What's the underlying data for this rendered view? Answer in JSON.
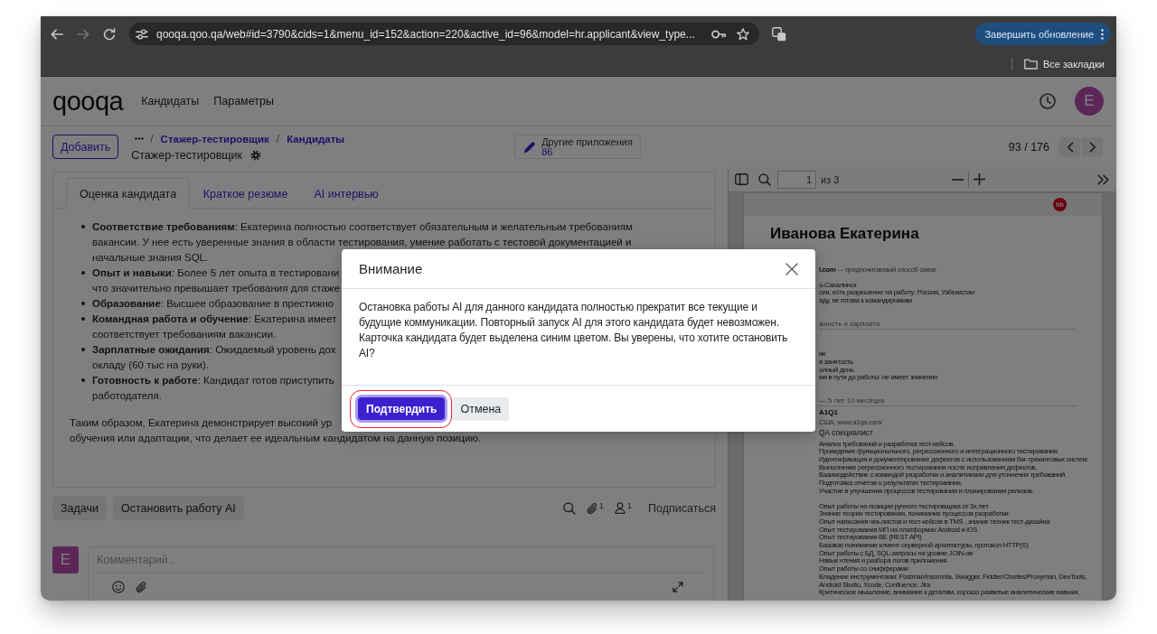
{
  "browser": {
    "nav": [
      {
        "kind": "back",
        "disabled": false
      },
      {
        "kind": "forward",
        "disabled": true
      },
      {
        "kind": "reload",
        "disabled": false
      }
    ],
    "url": "qooqa.qoo.qa/web#id=3790&cids=1&menu_id=152&action=220&active_id=96&model=hr.applicant&view_type...",
    "update_button": "Завершить обновление",
    "bookmarks_folder": "Все закладки"
  },
  "app_header": {
    "logo": "qooqa",
    "menu": [
      "Кандидаты",
      "Параметры"
    ],
    "avatar": "E"
  },
  "control_panel": {
    "new_button": "Добавить",
    "breadcrumbs": [
      {
        "separator": "/",
        "label": "Стажер-тестировщик"
      },
      {
        "separator": "/",
        "label": "Кандидаты"
      }
    ],
    "record_title": "Стажер-тестировщик",
    "smart_button": {
      "label": "Другие приложения",
      "count": "86"
    },
    "pager": "93 / 176"
  },
  "notebook": {
    "tabs": [
      {
        "label": "Оценка кандидата",
        "selected": true
      },
      {
        "label": "Краткое резюме",
        "selected": false
      },
      {
        "label": "AI интервью",
        "selected": false
      }
    ],
    "items": [
      {
        "lines": [
          "**Соответствие требованиям**: Екатерина полностью соответствует обязательным и желательным требованиям",
          "вакансии. У нее есть уверенные знания в области тестирования, умение работать с тестовой документацией и",
          "начальные знания SQL."
        ]
      },
      {
        "lines": [
          "**Опыт и навыки**: Более 5 лет опыта в тестировани",
          "что значительно превышает требования для стаже"
        ]
      },
      {
        "lines": [
          "**Образование**: Высшее образование в престижно"
        ]
      },
      {
        "lines": [
          "**Командная работа и обучение**: Екатерина имеет",
          "соответствует требованиям вакансии."
        ]
      },
      {
        "lines": [
          "**Зарплатные ожидания**: Ожидаемый уровень дох",
          "окладу (60 тыс на руки)."
        ]
      },
      {
        "lines": [
          "**Готовность к работе**: Кандидат готов приступить",
          "работодателя."
        ]
      }
    ],
    "summary": [
      "Таким образом, Екатерина демонстрирует высокий ур",
      "обучения или адаптации, что делает ее идеальным кандидатом на данную позицию."
    ]
  },
  "chatter": {
    "buttons": [
      "Задачи",
      "Остановить работу AI"
    ],
    "attachments": "1",
    "followers": "1",
    "follow": "Подписаться",
    "avatar": "E",
    "comment_placeholder": "Комментарий.."
  },
  "pdf_viewer": {
    "page": "1",
    "of_pages": "из 3",
    "document": {
      "logo": "hh",
      "name": "Иванова Екатерина",
      "blocks": [
        {
          "kind": "contact",
          "lines": [
            "**l.com** — предпочитаемый способ связи"
          ]
        },
        {
          "kind": "paragraph",
          "lines": [
            "о-Сахалинск",
            "сия, есть разрешение на работу: Россия, Узбекистан",
            "аду, не готова к командировкам"
          ]
        },
        {
          "kind": "section",
          "text": "жность и зарплата"
        },
        {
          "kind": "paragraph",
          "lines": [
            "ик",
            "я занятость",
            "олный день",
            "мя в пути до работы: не имеет значения"
          ]
        },
        {
          "kind": "section",
          "text": "— 5 лет 10 месяцев"
        },
        {
          "kind": "company",
          "text": "A1Q1"
        },
        {
          "kind": "muted",
          "text": "США, www.a1qa.com/"
        },
        {
          "kind": "position",
          "text": "QA специалист"
        },
        {
          "kind": "paragraph",
          "lines": [
            "Анализ требований и разработка тест-кейсов.",
            "Проведение функционального, регрессионного и интеграционного тестирования.",
            "Идентификация и документирование дефектов с использованием баг-трекинговых систем.",
            "Выполнение регрессионного тестирования после исправления дефектов.",
            "Взаимодействие с командой разработки и аналитиками для уточнения требований.",
            "Подготовка отчетов о результатах тестирования.",
            "Участие в улучшении процессов тестирования и планировании релизов."
          ]
        },
        {
          "kind": "paragraph",
          "lines": [
            "Опыт работы на позиции ручного тестировщика от 3х лет",
            "Знание теории тестирования, понимание процессов разработки",
            "Опыт написания чек-листов и тест-кейсов в TMS , знание техник тест-дизайна",
            "Опыт тестирования МП на платформах Android и iOS",
            "Опыт тестирования BE (REST API)",
            "Базовое понимание клиент-серверной архитектуры, протокол HTTP(S)",
            "Опыт работы с БД, SQL-запросы на уровне JOIN-ов",
            "Навык чтения и разбора логов приложения",
            "Опыт работы со снифферами",
            "Владение инструментами: Postman/Insomnia, Swagger, Fiddler/Charles/Proxyman, DevTools,",
            "Android Studio, Xcode, Confluence, Jira",
            "Критическое мышление, внимание к деталям, хорошо развитые аналитические навыки,"
          ]
        }
      ]
    }
  },
  "modal": {
    "title": "Внимание",
    "message": "Остановка работы AI для данного кандидата полностью прекратит все текущие и будущие коммуникации. Повторный запуск AI для этого кандидата будет невозможен. Карточка кандидата будет выделена синим цветом. Вы уверены, что хотите остановить AI?",
    "buttons": [
      {
        "label": "Подтвердить",
        "kind": "primary",
        "focused": true,
        "highlighted": true
      },
      {
        "label": "Отмена",
        "kind": "secondary",
        "focused": false,
        "highlighted": false
      }
    ]
  }
}
